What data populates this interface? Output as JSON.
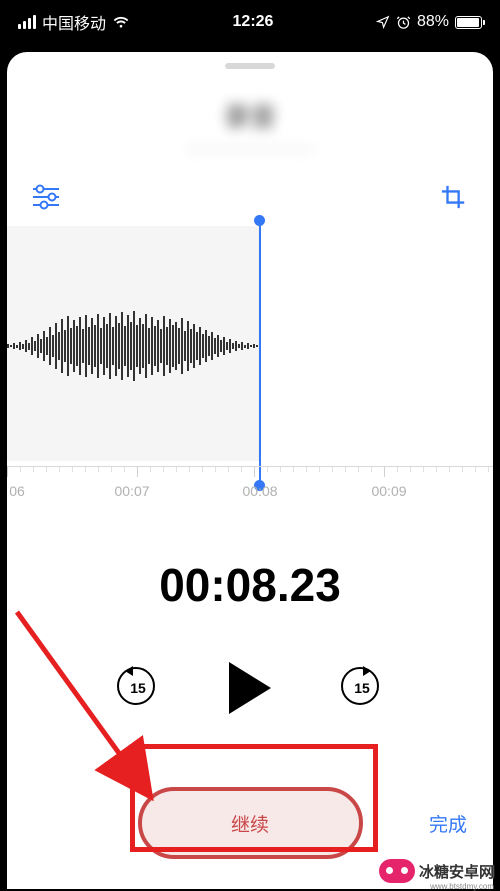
{
  "status": {
    "carrier": "中国移动",
    "time": "12:26",
    "battery_pct": "88%"
  },
  "header": {
    "title_blur": "录音",
    "subtitle_blur": "—————————"
  },
  "icons": {
    "settings": "settings-icon",
    "crop": "crop-icon",
    "skip_back": "15",
    "skip_fwd": "15"
  },
  "ruler": {
    "labels": [
      "06",
      "00:07",
      "00:08",
      "00:09"
    ]
  },
  "timer": "00:08.23",
  "buttons": {
    "continue": "继续",
    "done": "完成"
  },
  "watermark": {
    "text": "冰糖安卓网",
    "sub": "www.btstdmy.com"
  },
  "colors": {
    "accent": "#3478f6",
    "record_red": "#c94747",
    "annotation_red": "#e62020"
  }
}
